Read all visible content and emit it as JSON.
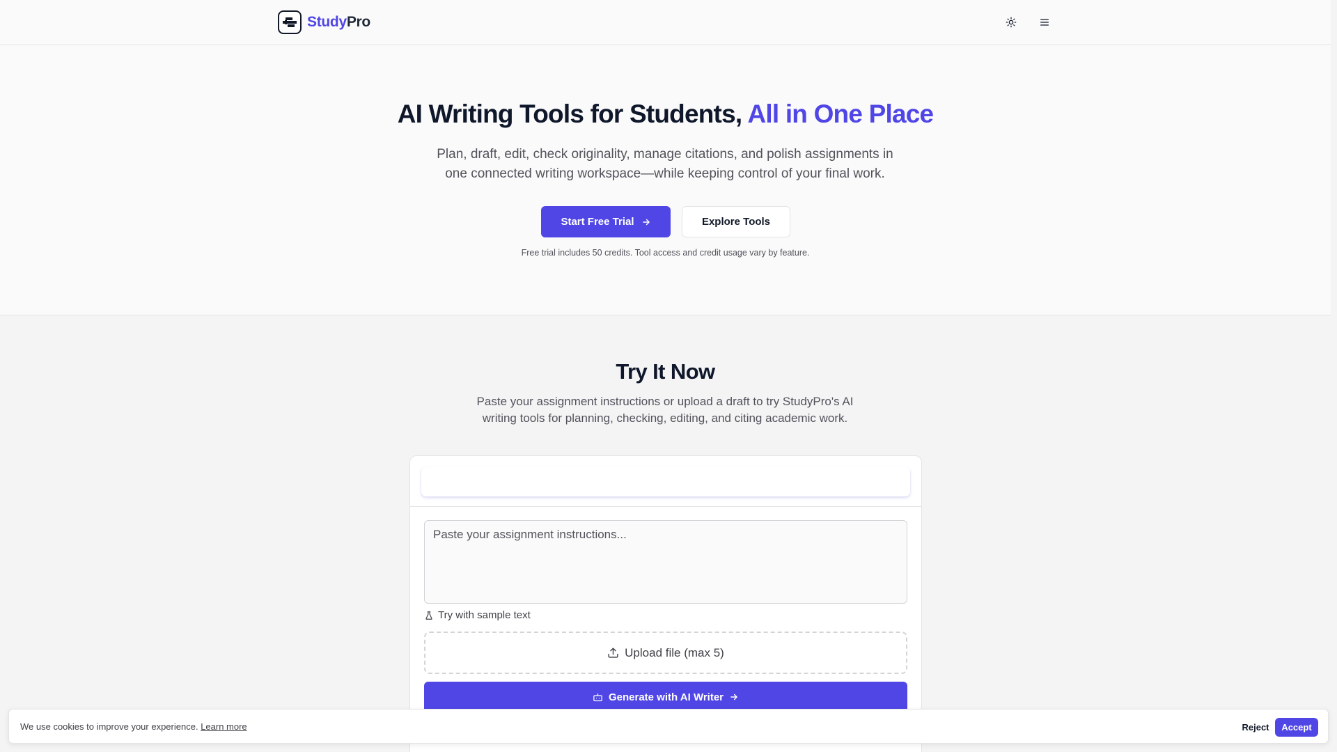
{
  "brand": {
    "name_part1": "Study",
    "name_part2": "Pro",
    "accent_color": "#4f46e5"
  },
  "header": {
    "theme_icon": "sun-icon",
    "menu_icon": "hamburger-menu-icon"
  },
  "hero": {
    "title_main": "AI Writing Tools for Students, ",
    "title_accent": "All in One Place",
    "subtitle": "Plan, draft, edit, check originality, manage citations, and polish assignments in one connected writing workspace—while keeping control of your final work.",
    "primary_cta": "Start Free Trial",
    "secondary_cta": "Explore Tools",
    "note": "Free trial includes 50 credits. Tool access and credit usage vary by feature."
  },
  "try_section": {
    "title": "Try It Now",
    "subtitle": "Paste your assignment instructions or upload a draft to try StudyPro's AI writing tools for planning, checking, editing, and citing academic work.",
    "textarea_placeholder": "Paste your assignment instructions...",
    "sample_label": "Try with sample text",
    "upload_label": "Upload file (max 5)",
    "generate_label": "Generate with AI Writer"
  },
  "cookie": {
    "text": "We use cookies to improve your experience.",
    "learn_more": "Learn more",
    "reject": "Reject",
    "accept": "Accept"
  }
}
